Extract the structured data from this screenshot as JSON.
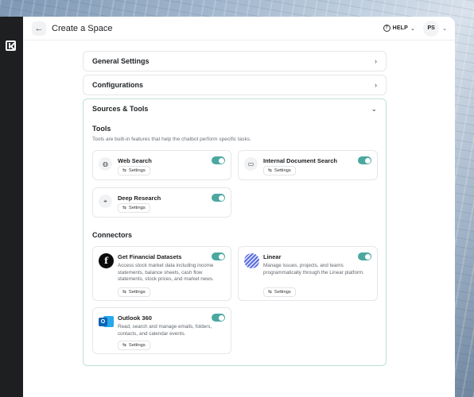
{
  "header": {
    "title": "Create a Space",
    "help_label": "HELP",
    "avatar_initials": "PS"
  },
  "accordions": {
    "general": "General Settings",
    "configurations": "Configurations",
    "sources": "Sources & Tools"
  },
  "tools": {
    "title": "Tools",
    "description": "Tools are built-in features that help the chatbot perform specific tasks.",
    "items": [
      {
        "name": "Web Search",
        "settings": "Settings",
        "enabled": true,
        "icon": "globe-icon"
      },
      {
        "name": "Internal Document Search",
        "settings": "Settings",
        "enabled": true,
        "icon": "folder-icon"
      },
      {
        "name": "Deep Research",
        "settings": "Settings",
        "enabled": true,
        "icon": "telescope-icon"
      }
    ]
  },
  "connectors": {
    "title": "Connectors",
    "items": [
      {
        "name": "Get Financial Datasets",
        "description": "Access stock market data including income statements, balance sheets, cash flow statements, stock prices, and market news.",
        "settings": "Settings",
        "enabled": true,
        "logo_letter": "f"
      },
      {
        "name": "Linear",
        "description": "Manage issues, projects, and teams programmatically through the Linear platform.",
        "settings": "Settings",
        "enabled": true
      },
      {
        "name": "Outlook 360",
        "description": "Read, search and manage emails, folders, contacts, and calendar events.",
        "settings": "Settings",
        "enabled": true,
        "logo_letter": "O"
      }
    ]
  },
  "colors": {
    "accent": "#4aa8a0",
    "rail": "#1e1f21"
  }
}
